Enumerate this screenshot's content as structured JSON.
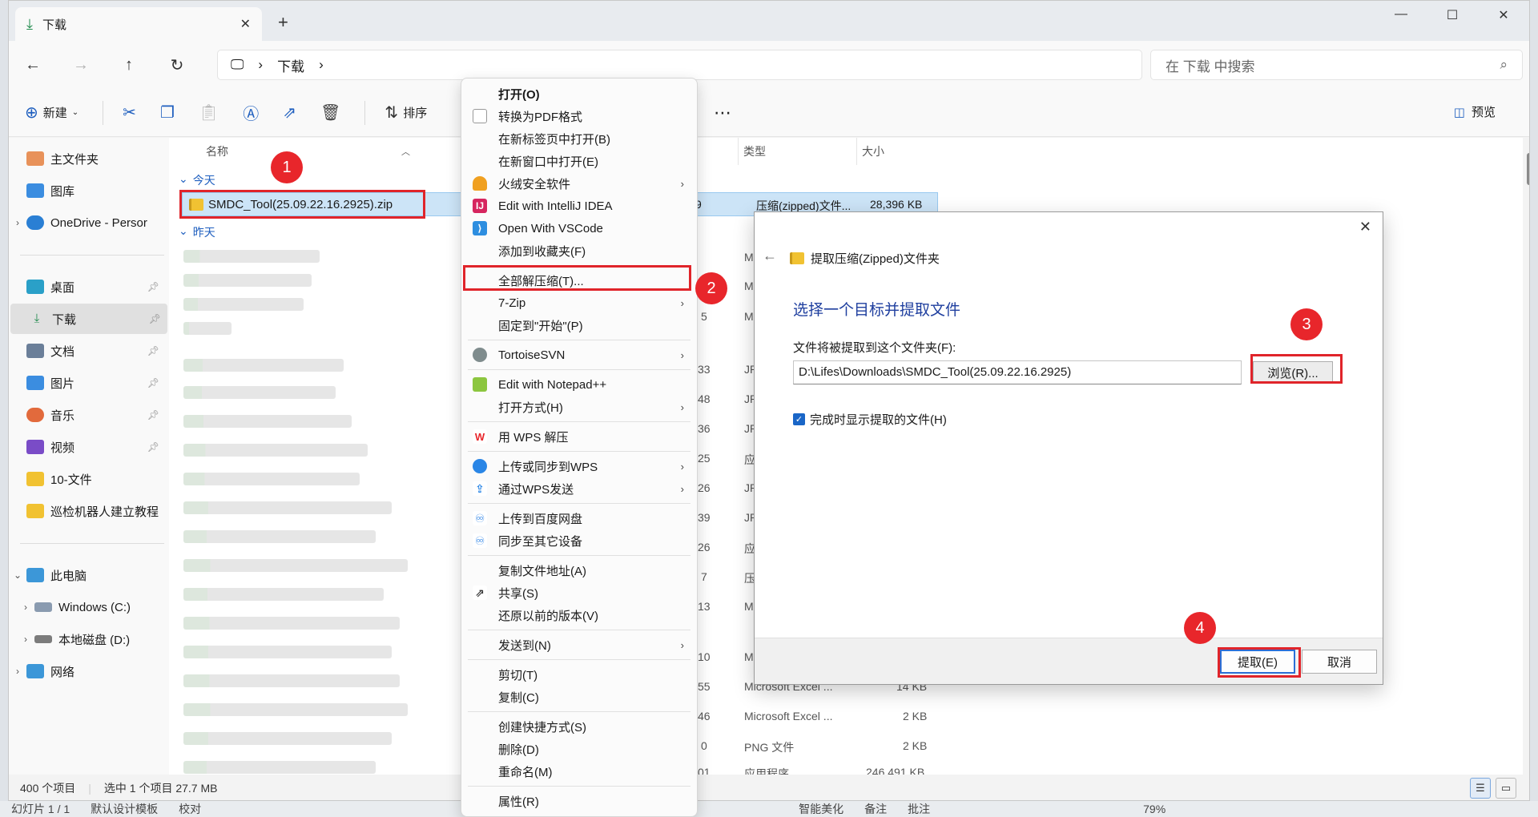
{
  "tab": {
    "title": "下载"
  },
  "address": {
    "folder": "下载",
    "search_placeholder": "在 下载 中搜索"
  },
  "toolbar": {
    "new_label": "新建",
    "sort_label": "排序",
    "preview_label": "预览"
  },
  "sidebar": {
    "home": "主文件夹",
    "gallery": "图库",
    "onedrive": "OneDrive - Persor",
    "desktop": "桌面",
    "downloads": "下载",
    "documents": "文档",
    "pictures": "图片",
    "music": "音乐",
    "videos": "视频",
    "folder1": "10-文件",
    "folder2": "巡检机器人建立教程",
    "thispc": "此电脑",
    "drive_c": "Windows (C:)",
    "drive_d": "本地磁盘 (D:)",
    "network": "网络"
  },
  "columns": {
    "name": "名称",
    "type": "类型",
    "size": "大小"
  },
  "groups": {
    "today": "今天",
    "yesterday": "昨天"
  },
  "selected_file": {
    "name": "SMDC_Tool(25.09.22.16.2925).zip",
    "date_tail": "9",
    "type": "压缩(zipped)文件...",
    "size": "28,396 KB"
  },
  "rows": [
    {
      "date": "",
      "type": "Mic",
      "size": ""
    },
    {
      "date": "",
      "type": "Mic",
      "size": ""
    },
    {
      "date": "5",
      "type": "Mic",
      "size": ""
    },
    {
      "date": "33",
      "type": "JPE",
      "size": ""
    },
    {
      "date": "48",
      "type": "JPE",
      "size": ""
    },
    {
      "date": "36",
      "type": "JPE",
      "size": ""
    },
    {
      "date": "25",
      "type": "应用",
      "size": ""
    },
    {
      "date": "26",
      "type": "JPE",
      "size": ""
    },
    {
      "date": "39",
      "type": "JPE",
      "size": ""
    },
    {
      "date": "26",
      "type": "应用",
      "size": ""
    },
    {
      "date": "7",
      "type": "压缩",
      "size": ""
    },
    {
      "date": "13",
      "type": "Mic",
      "size": ""
    },
    {
      "date": "10",
      "type": "MP",
      "size": ""
    },
    {
      "date": "55",
      "type": "Microsoft Excel ...",
      "size": "14 KB"
    },
    {
      "date": "46",
      "type": "Microsoft Excel ...",
      "size": "2 KB"
    },
    {
      "date": "0",
      "type": "PNG 文件",
      "size": "2 KB"
    },
    {
      "date": "01",
      "type": "应用程序",
      "size": "246,491 KB"
    }
  ],
  "status": {
    "count": "400 个项目",
    "selection": "选中 1 个项目  27.7 MB"
  },
  "taskstrip": {
    "slide": "幻灯片 1 / 1",
    "template": "默认设计模板",
    "proof": "校对",
    "beauty": "智能美化",
    "notes": "备注",
    "comment": "批注",
    "zoom": "79%"
  },
  "context_menu": {
    "open": "打开(O)",
    "to_pdf": "转换为PDF格式",
    "open_new_tab": "在新标签页中打开(B)",
    "open_new_window": "在新窗口中打开(E)",
    "huorong": "火绒安全软件",
    "idea": "Edit with IntelliJ IDEA",
    "vscode": "Open With VSCode",
    "add_fav": "添加到收藏夹(F)",
    "extract_all": "全部解压缩(T)...",
    "zip7": "7-Zip",
    "pin_start": "固定到\"开始\"(P)",
    "svn": "TortoiseSVN",
    "notepad": "Edit with Notepad++",
    "open_with": "打开方式(H)",
    "wps_unzip": "用 WPS 解压",
    "wps_upload": "上传或同步到WPS",
    "wps_send": "通过WPS发送",
    "baidu": "上传到百度网盘",
    "sync_dev": "同步至其它设备",
    "copy_path": "复制文件地址(A)",
    "share": "共享(S)",
    "restore": "还原以前的版本(V)",
    "send_to": "发送到(N)",
    "cut": "剪切(T)",
    "copy": "复制(C)",
    "shortcut": "创建快捷方式(S)",
    "delete": "删除(D)",
    "rename": "重命名(M)",
    "properties": "属性(R)"
  },
  "dialog": {
    "title": "提取压缩(Zipped)文件夹",
    "heading": "选择一个目标并提取文件",
    "dest_label": "文件将被提取到这个文件夹(F):",
    "dest_path": "D:\\Lifes\\Downloads\\SMDC_Tool(25.09.22.16.2925)",
    "browse": "浏览(R)...",
    "show_files": "完成时显示提取的文件(H)",
    "extract": "提取(E)",
    "cancel": "取消"
  },
  "annotations": {
    "b1": "1",
    "b2": "2",
    "b3": "3",
    "b4": "4"
  },
  "colors": {
    "accent": "#1f5fbf",
    "annotation_red": "#e0242a",
    "selection": "#cce4f7"
  }
}
